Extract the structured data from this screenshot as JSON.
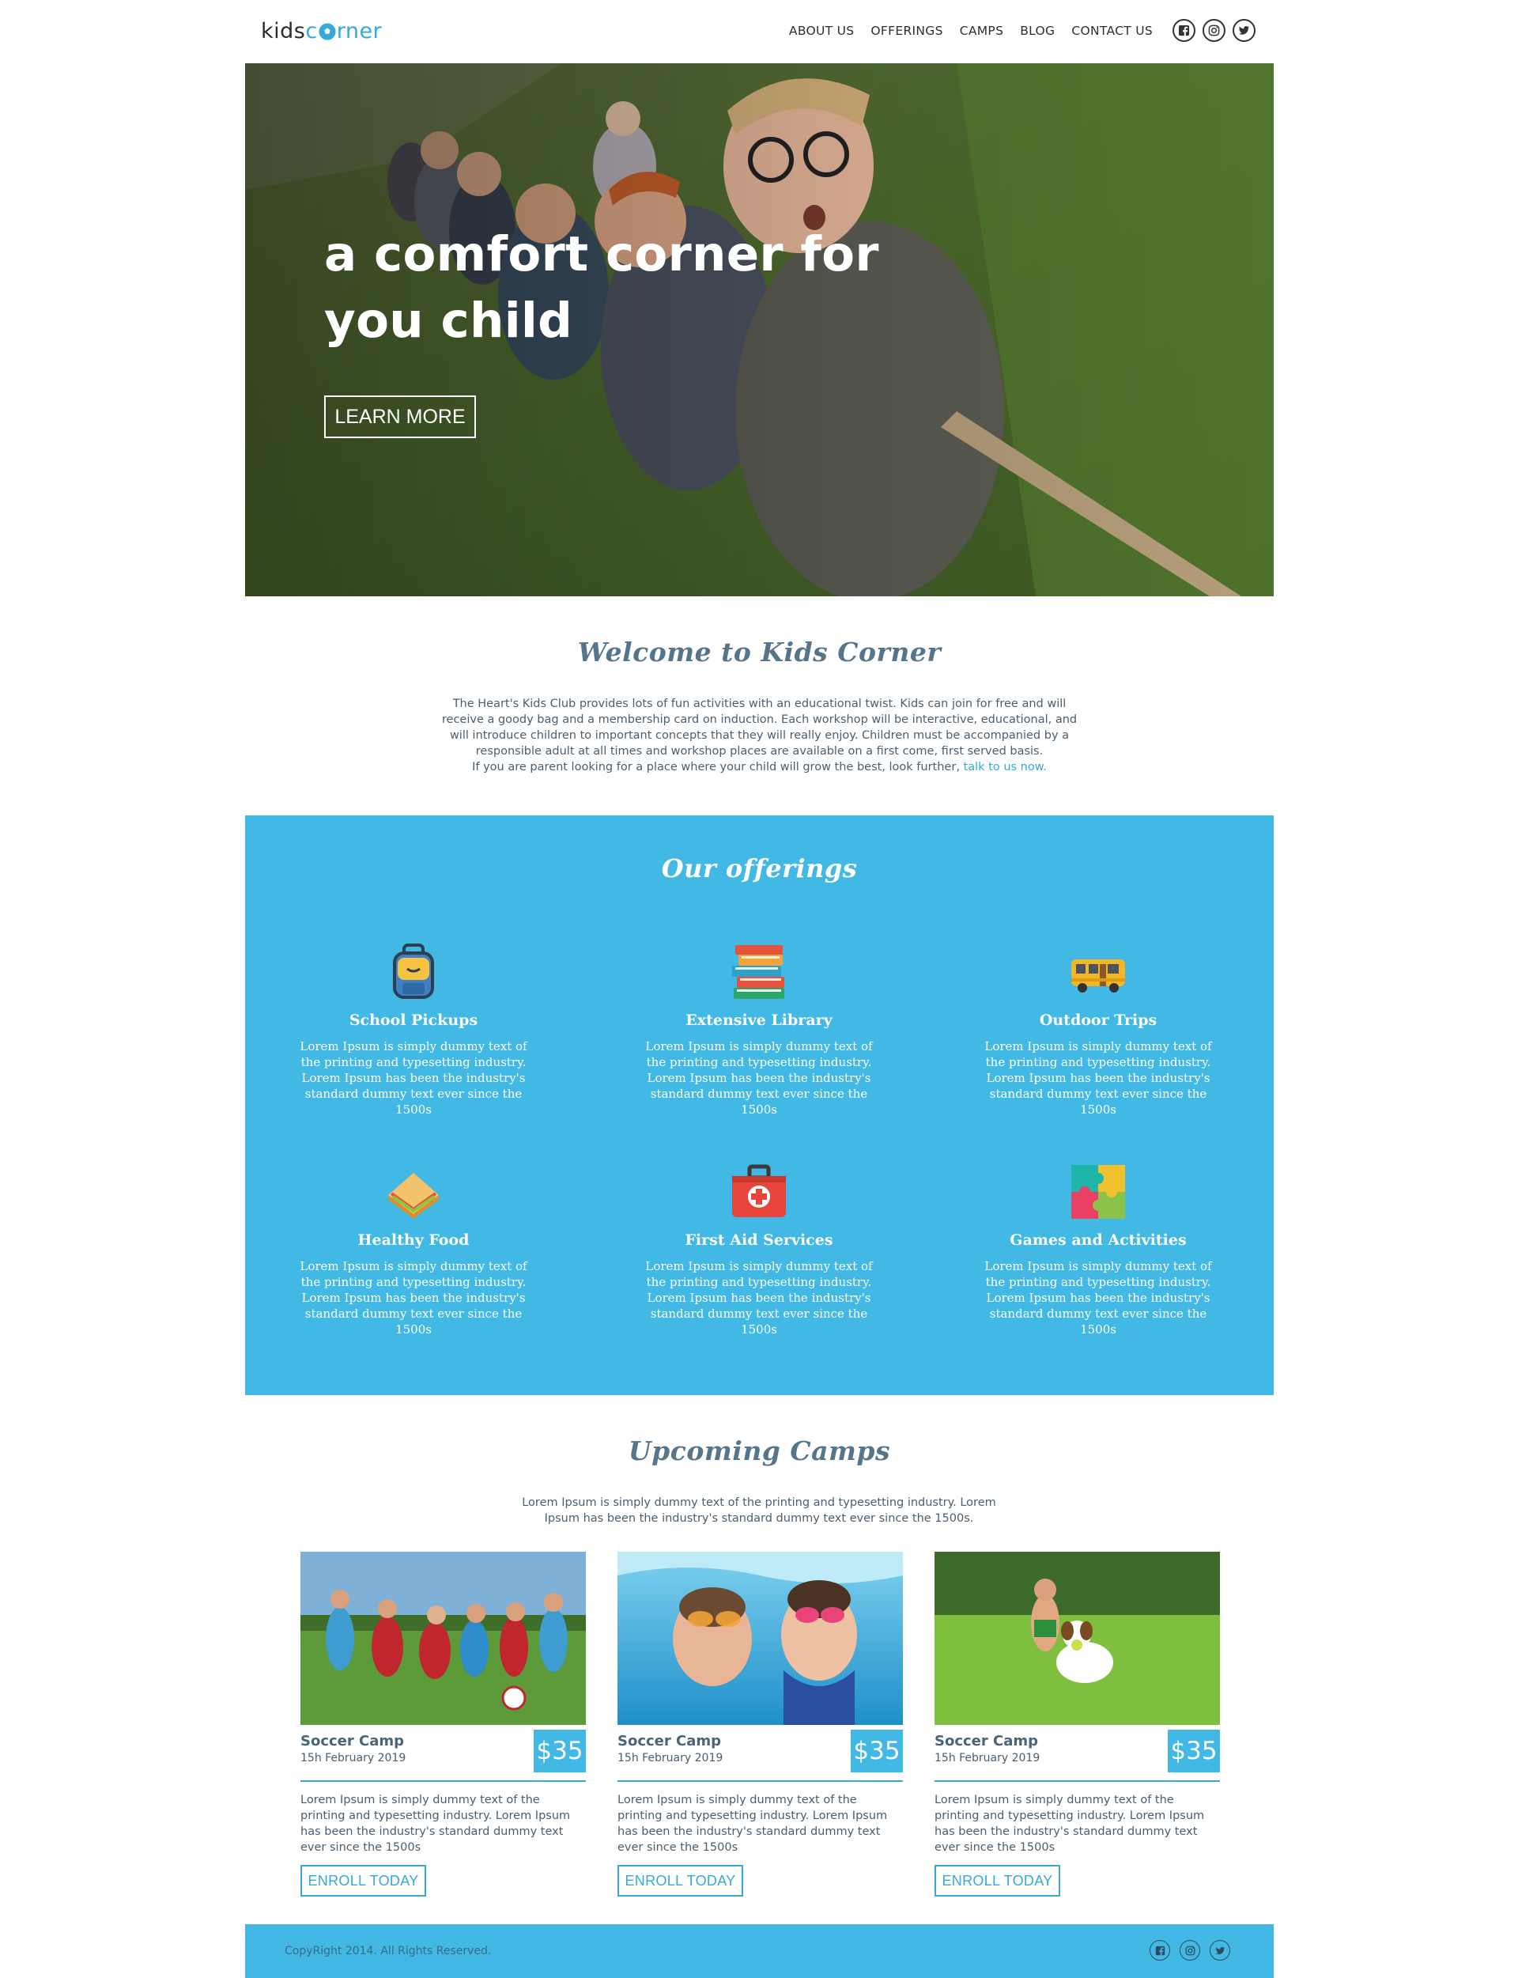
{
  "header": {
    "logo_part1": "kids",
    "logo_part2": "c",
    "logo_part3": "rner",
    "nav": [
      "ABOUT US",
      "OFFERINGS",
      "CAMPS",
      "BLOG",
      "CONTACT US"
    ]
  },
  "hero": {
    "title": "a comfort corner for you child",
    "button_label": "LEARN MORE"
  },
  "welcome": {
    "title": "Welcome to Kids Corner",
    "text": "The Heart's Kids Club provides lots of fun activities with an educational twist. Kids can join for free and will receive a goody bag and a membership card on induction. Each workshop will be interactive, educational, and will introduce children to important concepts that they will really enjoy. Children must be accompanied by a responsible adult at all times and workshop places are available on a first come, first served basis.",
    "text2": "If you are parent looking for a place where your child will grow the best, look further,",
    "link": "talk to us now."
  },
  "offerings": {
    "title": "Our offerings",
    "items": [
      {
        "name": "School Pickups",
        "icon": "backpack-icon",
        "desc": "Lorem Ipsum is simply dummy text of the printing and typesetting industry. Lorem Ipsum has been the industry's standard dummy text ever since the 1500s"
      },
      {
        "name": "Extensive Library",
        "icon": "books-icon",
        "desc": "Lorem Ipsum is simply dummy text of the printing and typesetting industry. Lorem Ipsum has been the industry's standard dummy text ever since the 1500s"
      },
      {
        "name": "Outdoor Trips",
        "icon": "bus-icon",
        "desc": "Lorem Ipsum is simply dummy text of the printing and typesetting industry. Lorem Ipsum has been the industry's standard dummy text ever since the 1500s"
      },
      {
        "name": "Healthy Food",
        "icon": "sandwich-icon",
        "desc": "Lorem Ipsum is simply dummy text of the printing and typesetting industry. Lorem Ipsum has been the industry's standard dummy text ever since the 1500s"
      },
      {
        "name": "First Aid Services",
        "icon": "first-aid-kit-icon",
        "desc": "Lorem Ipsum is simply dummy text of the printing and typesetting industry. Lorem Ipsum has been the industry's standard dummy text ever since the 1500s"
      },
      {
        "name": "Games and Activities",
        "icon": "puzzle-icon",
        "desc": "Lorem Ipsum is simply dummy text of the printing and typesetting industry. Lorem Ipsum has been the industry's standard dummy text ever since the 1500s"
      }
    ]
  },
  "camps": {
    "title": "Upcoming Camps",
    "subtitle": "Lorem Ipsum is simply dummy text of the printing and typesetting industry. Lorem Ipsum has been the industry's standard dummy text ever since the 1500s.",
    "cards": [
      {
        "name": "Soccer Camp",
        "date": "15h February 2019",
        "price": "$35",
        "desc": "Lorem Ipsum is simply dummy text of the printing and typesetting industry. Lorem Ipsum has been the industry's standard dummy text ever since the 1500s",
        "button": "ENROLL TODAY"
      },
      {
        "name": "Soccer Camp",
        "date": "15h February 2019",
        "price": "$35",
        "desc": "Lorem Ipsum is simply dummy text of the printing and typesetting industry. Lorem Ipsum has been the industry's standard dummy text ever since the 1500s",
        "button": "ENROLL TODAY"
      },
      {
        "name": "Soccer Camp",
        "date": "15h February 2019",
        "price": "$35",
        "desc": "Lorem Ipsum is simply dummy text of the printing and typesetting industry. Lorem Ipsum has been the industry's standard dummy text ever since the 1500s",
        "button": "ENROLL TODAY"
      }
    ]
  },
  "footer": {
    "copyright": "CopyRight 2014. All Rights Reserved."
  },
  "colors": {
    "accent": "#42b8e4",
    "heading": "#56758a",
    "text": "#4a5e6e"
  }
}
